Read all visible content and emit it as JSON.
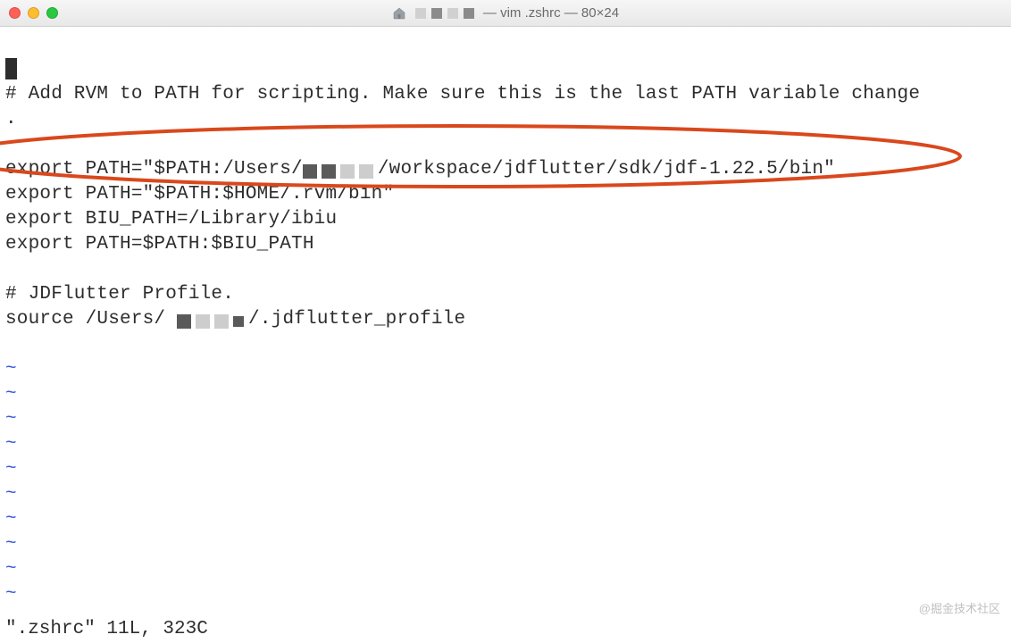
{
  "titlebar": {
    "title_suffix": " — vim .zshrc — 80×24"
  },
  "editor": {
    "lines": [
      "",
      "# Add RVM to PATH for scripting. Make sure this is the last PATH variable change",
      ".",
      "",
      "export PATH=\"$PATH:/Users/",
      "/workspace/jdflutter/sdk/jdf-1.22.5/bin\"",
      "export PATH=\"$PATH:$HOME/.rvm/bin\"",
      "export BIU_PATH=/Library/ibiu",
      "export PATH=$PATH:$BIU_PATH",
      "",
      "# JDFlutter Profile.",
      "source /Users/",
      "/.jdflutter_profile"
    ],
    "tilde": "~",
    "status": "\".zshrc\" 11L, 323C"
  },
  "watermark": "@掘金技术社区"
}
